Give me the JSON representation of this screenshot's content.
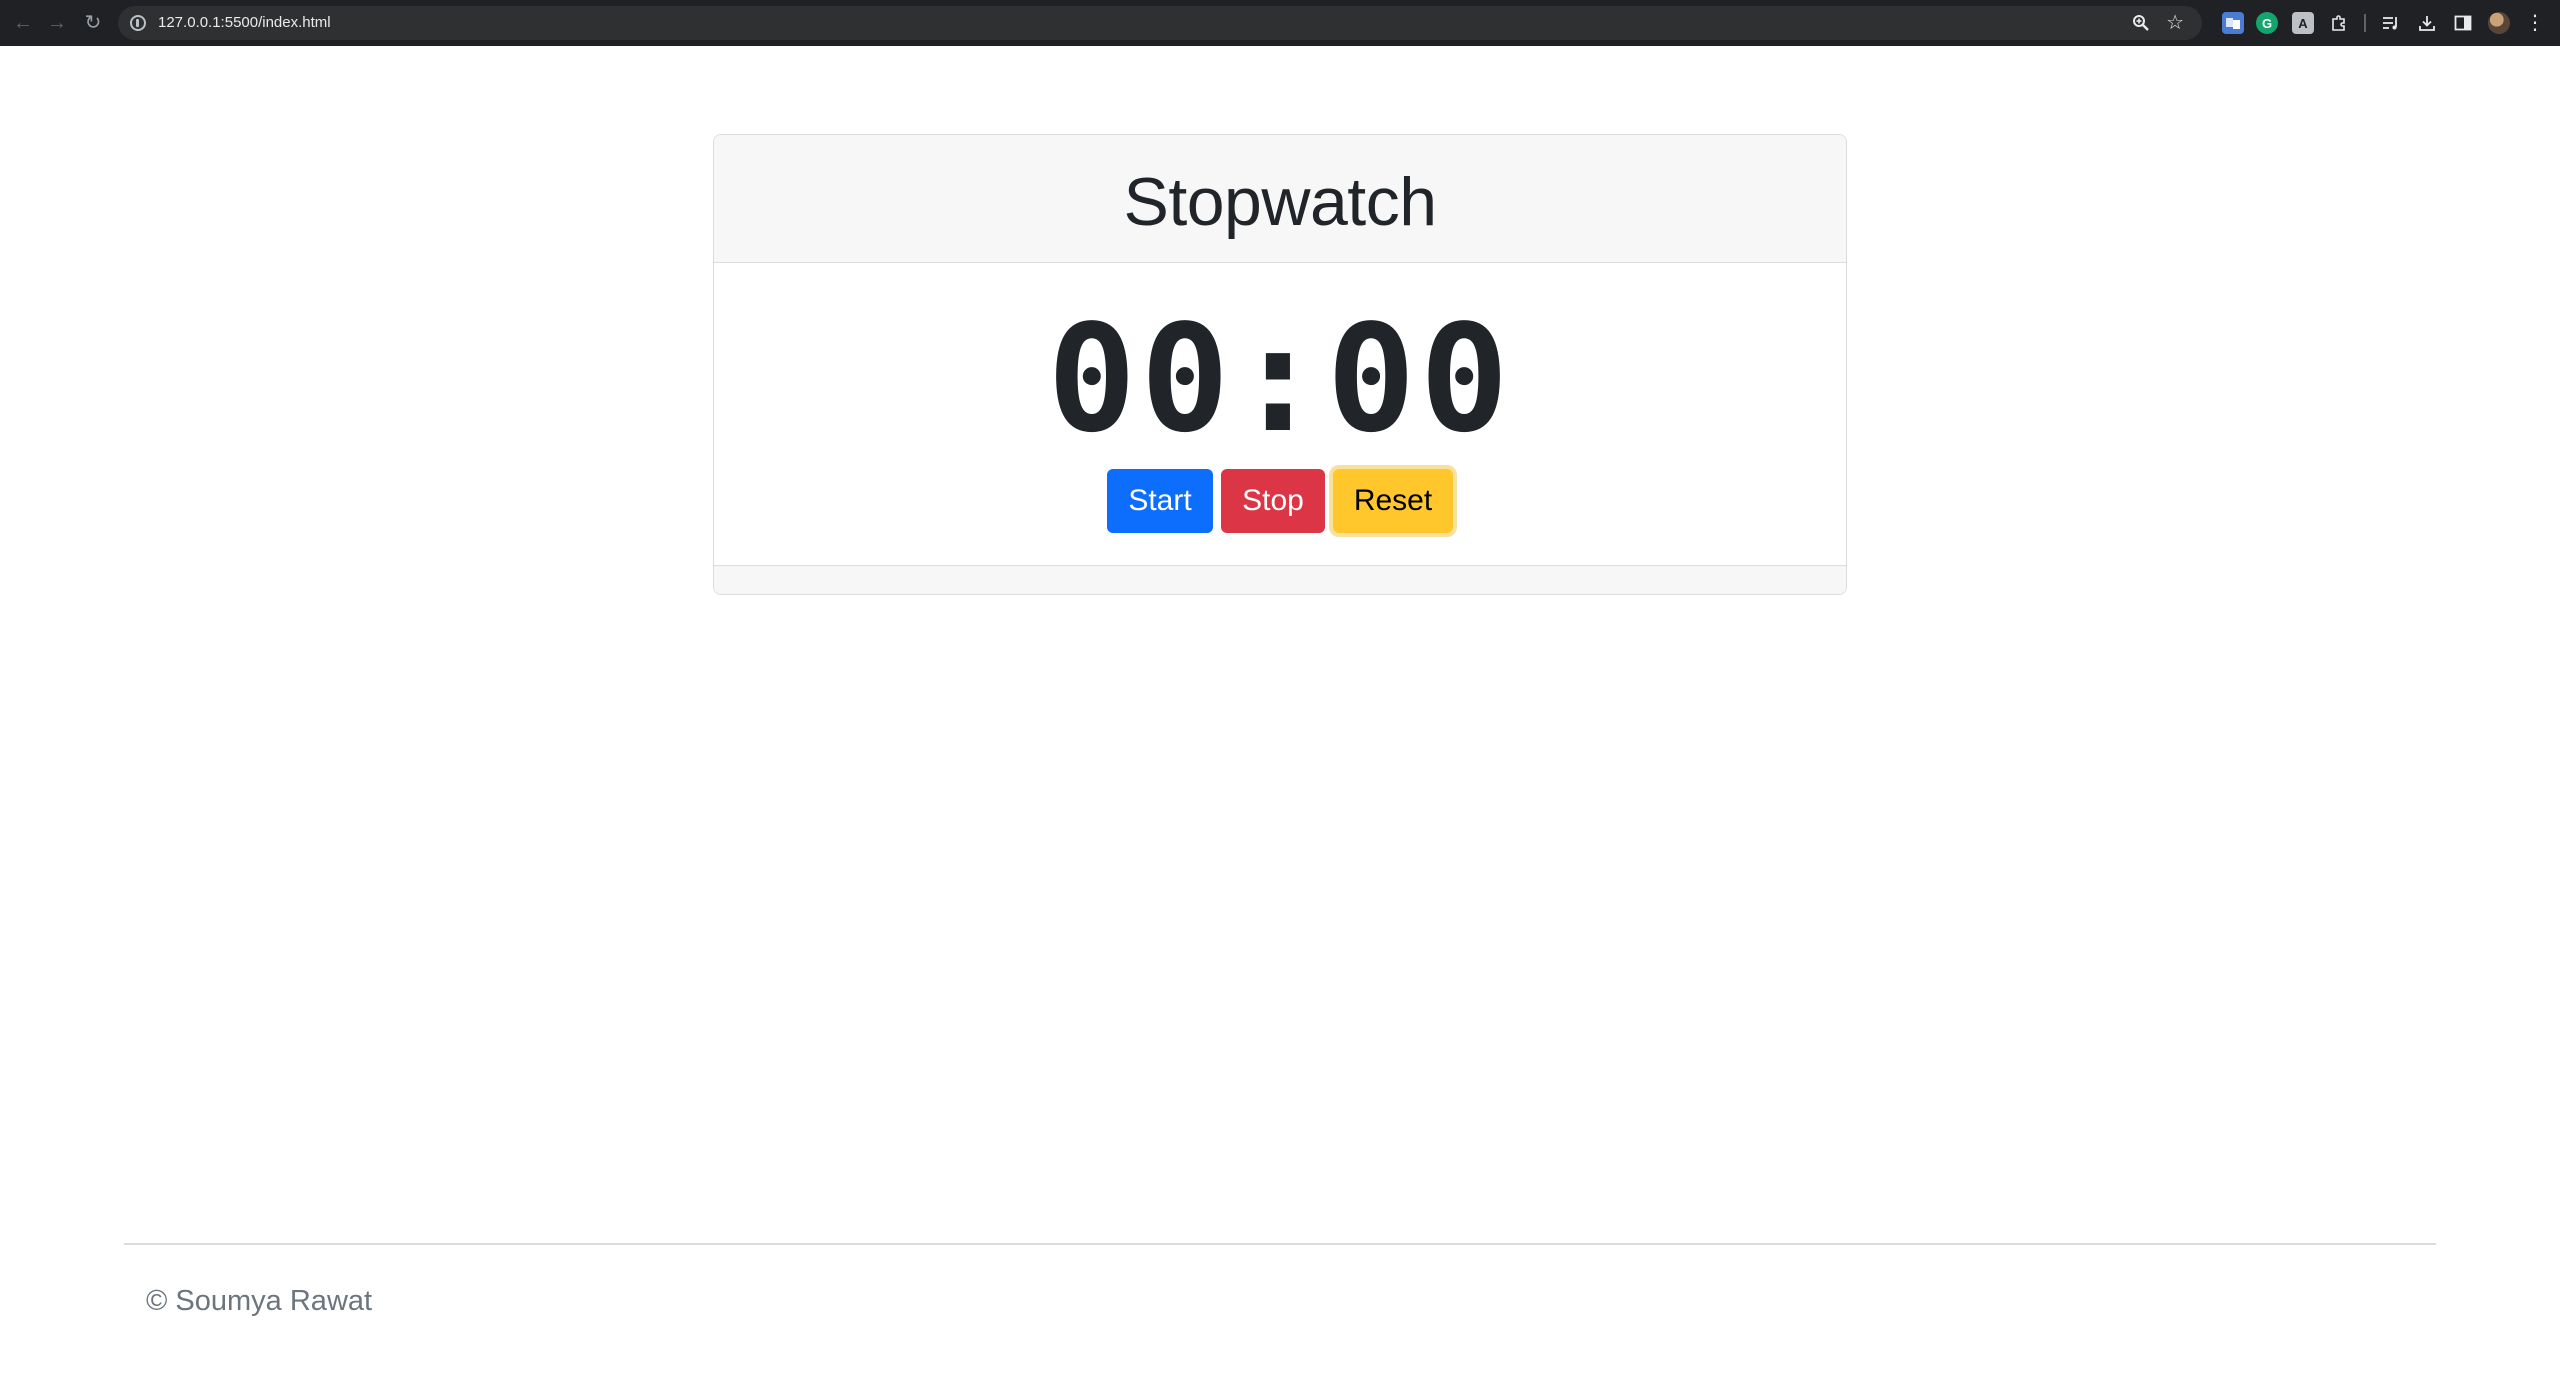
{
  "browser": {
    "url": "127.0.0.1:5500/index.html",
    "icons": [
      "back-arrow-icon",
      "forward-arrow-icon",
      "reload-icon",
      "site-info-icon",
      "zoom-icon",
      "star-icon",
      "translate-extension-icon",
      "grammarly-extension-icon",
      "pocket-extension-icon",
      "extensions-puzzle-icon",
      "media-controls-icon",
      "download-icon",
      "side-panel-icon",
      "profile-avatar",
      "more-menu-icon"
    ],
    "grammarly_glyph": "G",
    "pocket_glyph": "A"
  },
  "stopwatch": {
    "title": "Stopwatch",
    "time": "00:00",
    "buttons": {
      "start": "Start",
      "stop": "Stop",
      "reset": "Reset"
    }
  },
  "footer": {
    "text": "© Soumya Rawat"
  },
  "colors": {
    "start": "#0d6efd",
    "stop": "#dc3545",
    "reset": "#ffc72c",
    "text": "#212529",
    "muted": "#6c757d"
  }
}
